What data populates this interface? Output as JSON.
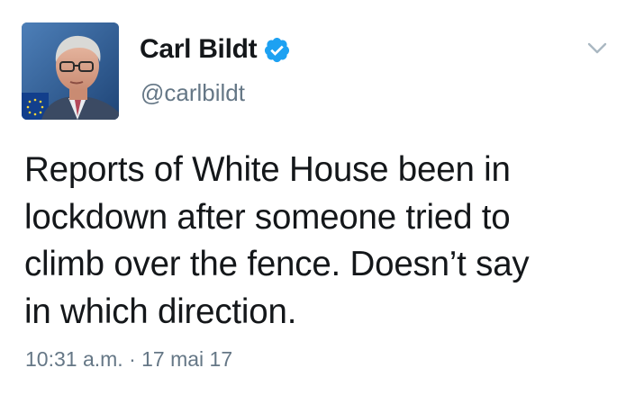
{
  "author": {
    "name": "Carl Bildt",
    "handle": "@carlbildt",
    "verified": true
  },
  "tweet": {
    "lines": [
      "Reports of White House been in",
      "lockdown after someone tried to",
      "climb over the fence. Doesn’t say",
      "in which direction."
    ],
    "timestamp": "10:31 a.m. · 17 mai 17"
  },
  "icons": {
    "verified": "verified-badge-icon",
    "menu": "chevron-down-icon"
  },
  "colors": {
    "verified_blue": "#1da1f2",
    "secondary_text": "#657786",
    "primary_text": "#14171a"
  }
}
